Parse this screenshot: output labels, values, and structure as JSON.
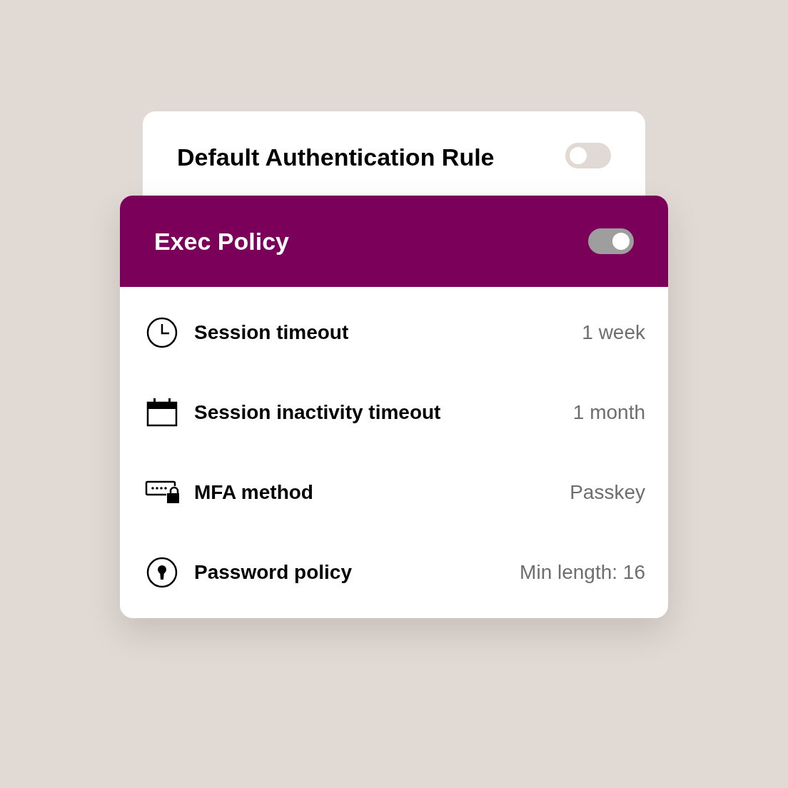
{
  "back_rule": {
    "title": "Default Authentication Rule",
    "on": false
  },
  "policy": {
    "title": "Exec Policy",
    "on": true,
    "rows": [
      {
        "kind": "clock",
        "label": "Session timeout",
        "value": "1 week"
      },
      {
        "kind": "calendar",
        "label": "Session inactivity timeout",
        "value": "1 month"
      },
      {
        "kind": "mfa",
        "label": "MFA method",
        "value": "Passkey"
      },
      {
        "kind": "keyhole",
        "label": "Password policy",
        "value": "Min length: 16"
      }
    ]
  }
}
